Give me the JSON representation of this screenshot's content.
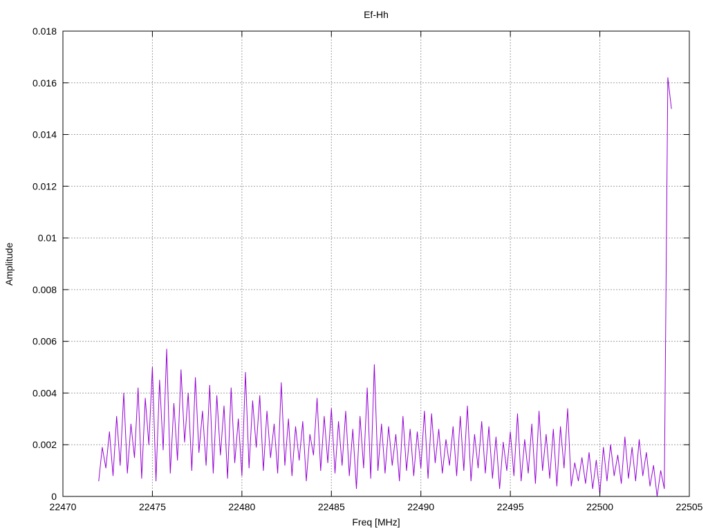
{
  "chart_data": {
    "type": "line",
    "title": "Ef-Hh",
    "xlabel": "Freq [MHz]",
    "ylabel": "Amplitude",
    "xlim": [
      22470,
      22505
    ],
    "ylim": [
      0,
      0.018
    ],
    "xticks": [
      "22470",
      "22475",
      "22480",
      "22485",
      "22490",
      "22495",
      "22500",
      "22505"
    ],
    "yticks": [
      "0",
      "0.002",
      "0.004",
      "0.006",
      "0.008",
      "0.01",
      "0.012",
      "0.014",
      "0.016",
      "0.018"
    ],
    "grid": true,
    "legend": "none",
    "series": [
      {
        "name": "Ef-Hh",
        "color": "#9400d3",
        "x_start": 22472,
        "x_step": 0.2,
        "values": [
          0.0006,
          0.0019,
          0.0011,
          0.0025,
          0.0008,
          0.0031,
          0.0012,
          0.004,
          0.0009,
          0.0028,
          0.0015,
          0.0042,
          0.0007,
          0.0038,
          0.002,
          0.005,
          0.0006,
          0.0045,
          0.0018,
          0.0057,
          0.0009,
          0.0036,
          0.0014,
          0.0049,
          0.0021,
          0.004,
          0.001,
          0.0046,
          0.0017,
          0.0033,
          0.0012,
          0.0043,
          0.0009,
          0.0039,
          0.0016,
          0.0035,
          0.0007,
          0.0042,
          0.0013,
          0.003,
          0.0008,
          0.0048,
          0.0011,
          0.0037,
          0.0019,
          0.0039,
          0.001,
          0.0033,
          0.0015,
          0.0028,
          0.0009,
          0.0044,
          0.0012,
          0.003,
          0.0008,
          0.0027,
          0.0014,
          0.0029,
          0.0006,
          0.0024,
          0.0016,
          0.0038,
          0.001,
          0.0031,
          0.0013,
          0.0034,
          0.0009,
          0.0029,
          0.0012,
          0.0033,
          0.0008,
          0.0026,
          0.0003,
          0.0031,
          0.0011,
          0.0042,
          0.0007,
          0.0051,
          0.001,
          0.0028,
          0.0009,
          0.0027,
          0.0012,
          0.0024,
          0.0006,
          0.0031,
          0.001,
          0.0026,
          0.0008,
          0.0025,
          0.0011,
          0.0033,
          0.0007,
          0.0032,
          0.0013,
          0.0026,
          0.0009,
          0.0022,
          0.0012,
          0.0027,
          0.0008,
          0.0031,
          0.001,
          0.0035,
          0.0006,
          0.0024,
          0.0011,
          0.0029,
          0.0009,
          0.0027,
          0.0007,
          0.0023,
          0.0003,
          0.0021,
          0.001,
          0.0025,
          0.0008,
          0.0032,
          0.0006,
          0.0022,
          0.0009,
          0.0028,
          0.0005,
          0.0033,
          0.001,
          0.0024,
          0.0007,
          0.0026,
          0.0004,
          0.0027,
          0.0011,
          0.0034,
          0.0004,
          0.0013,
          0.0006,
          0.0015,
          0.0005,
          0.0017,
          0.0003,
          0.0014,
          0.0001,
          0.0019,
          0.0006,
          0.002,
          0.0008,
          0.0016,
          0.0005,
          0.0023,
          0.0007,
          0.0019,
          0.0006,
          0.0022,
          0.0008,
          0.0017,
          0.0004,
          0.0012,
          0.0,
          0.001,
          0.0003,
          0.0162,
          0.015
        ]
      }
    ]
  }
}
